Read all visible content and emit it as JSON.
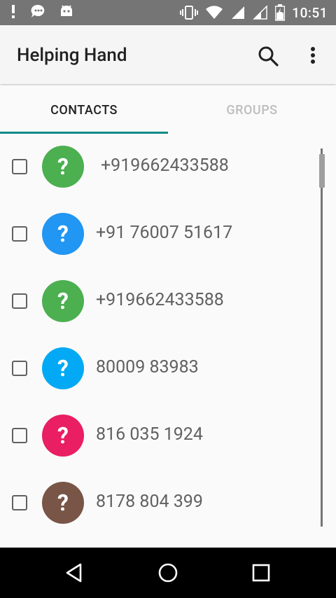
{
  "status_bar": {
    "time": "10:51",
    "left_icons": [
      "alert-icon",
      "chat-icon",
      "android-icon"
    ],
    "right_icons": [
      "vibrate-icon",
      "wifi-icon",
      "signal-icon",
      "signal-icon",
      "battery-icon"
    ]
  },
  "app_bar": {
    "title": "Helping Hand",
    "actions": [
      "search-icon",
      "more-vert-icon"
    ]
  },
  "tabs": [
    {
      "label": "CONTACTS",
      "active": true
    },
    {
      "label": "GROUPS",
      "active": false
    }
  ],
  "contacts": [
    {
      "number": "+919662433588",
      "color": "#4caf50",
      "avatar": "?"
    },
    {
      "number": "+91 76007 51617",
      "color": "#2196f3",
      "avatar": "?"
    },
    {
      "number": "+919662433588",
      "color": "#4caf50",
      "avatar": "?"
    },
    {
      "number": "80009 83983",
      "color": "#03a9f4",
      "avatar": "?"
    },
    {
      "number": "816 035 1924",
      "color": "#e91e63",
      "avatar": "?"
    },
    {
      "number": "8178 804 399",
      "color": "#795548",
      "avatar": "?"
    }
  ],
  "colors": {
    "accent": "#0b8a86",
    "statusbar": "#757575"
  }
}
